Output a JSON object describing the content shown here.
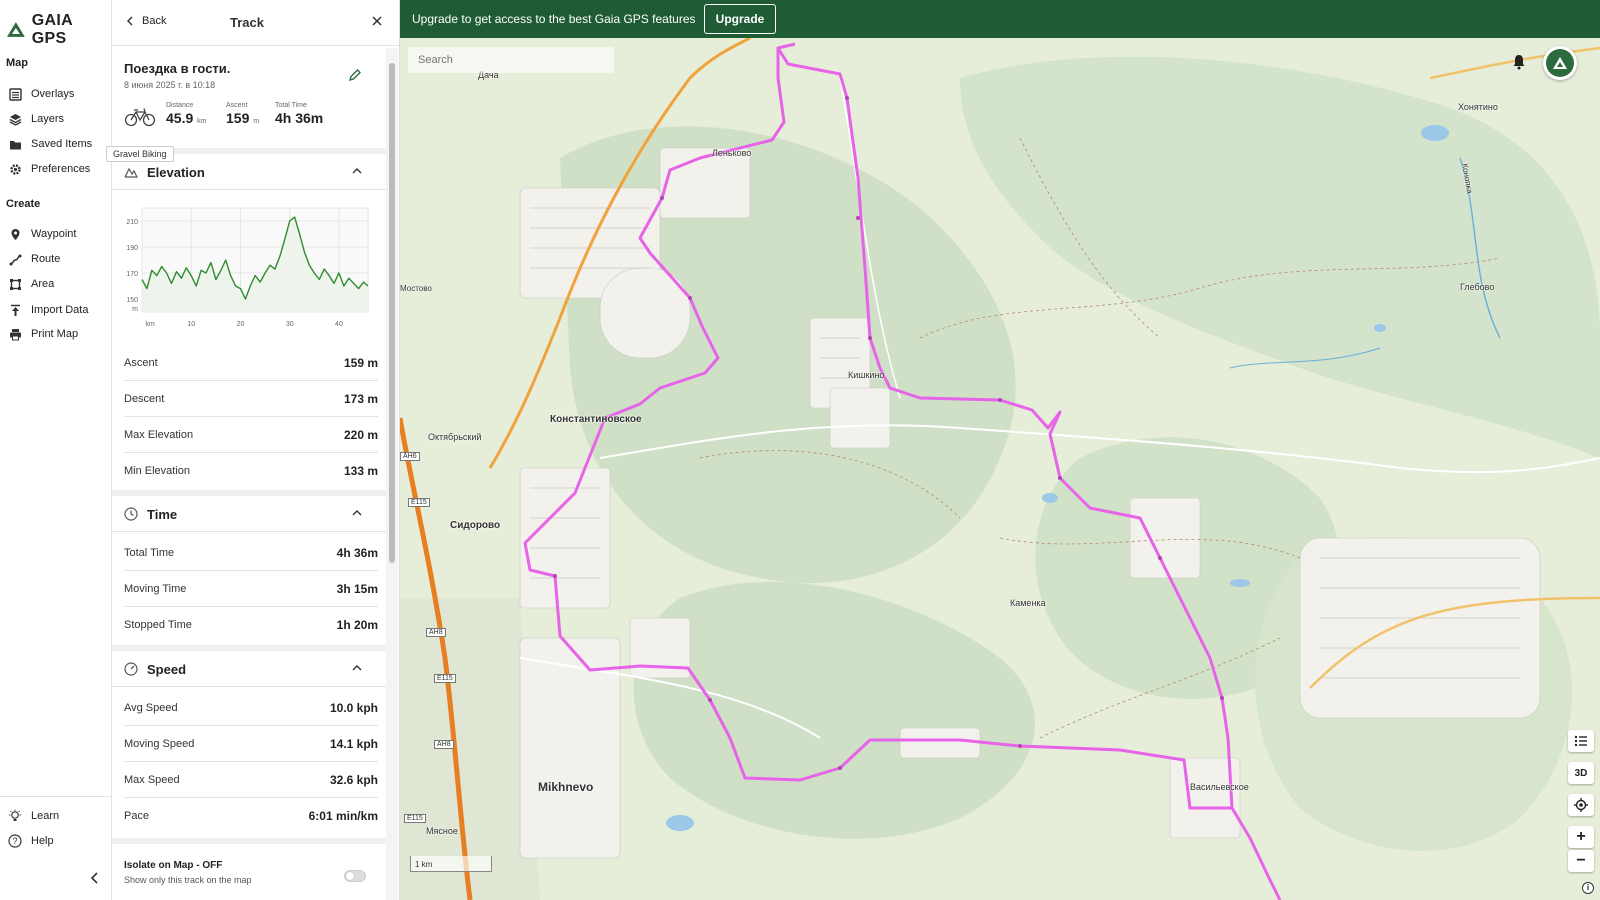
{
  "brand": {
    "name": "GAIA GPS"
  },
  "nav": {
    "map_heading": "Map",
    "map_items": [
      {
        "label": "Overlays",
        "icon": "overlays-icon"
      },
      {
        "label": "Layers",
        "icon": "layers-icon"
      },
      {
        "label": "Saved Items",
        "icon": "folder-icon"
      },
      {
        "label": "Preferences",
        "icon": "gear-icon"
      }
    ],
    "create_heading": "Create",
    "create_items": [
      {
        "label": "Waypoint",
        "icon": "pin-icon"
      },
      {
        "label": "Route",
        "icon": "route-icon"
      },
      {
        "label": "Area",
        "icon": "area-icon"
      },
      {
        "label": "Import Data",
        "icon": "upload-icon"
      },
      {
        "label": "Print Map",
        "icon": "printer-icon"
      }
    ],
    "bottom_items": [
      {
        "label": "Learn",
        "icon": "lightbulb-icon"
      },
      {
        "label": "Help",
        "icon": "help-icon"
      }
    ],
    "tooltip": "Gravel Biking"
  },
  "panel": {
    "back_label": "Back",
    "title": "Track",
    "track_name": "Поездка в гости.",
    "track_date": "8 июня 2025 г. в 10:18",
    "stats": {
      "distance_label": "Distance",
      "distance_value": "45.9",
      "distance_unit": "km",
      "ascent_label": "Ascent",
      "ascent_value": "159",
      "ascent_unit": "m",
      "time_label": "Total Time",
      "time_value": "4h 36m"
    },
    "elevation": {
      "title": "Elevation",
      "rows": [
        {
          "label": "Ascent",
          "value": "159 m"
        },
        {
          "label": "Descent",
          "value": "173 m"
        },
        {
          "label": "Max Elevation",
          "value": "220 m"
        },
        {
          "label": "Min Elevation",
          "value": "133 m"
        }
      ]
    },
    "time": {
      "title": "Time",
      "rows": [
        {
          "label": "Total Time",
          "value": "4h 36m"
        },
        {
          "label": "Moving Time",
          "value": "3h 15m"
        },
        {
          "label": "Stopped Time",
          "value": "1h 20m"
        }
      ]
    },
    "speed": {
      "title": "Speed",
      "rows": [
        {
          "label": "Avg Speed",
          "value": "10.0 kph"
        },
        {
          "label": "Moving Speed",
          "value": "14.1 kph"
        },
        {
          "label": "Max Speed",
          "value": "32.6 kph"
        },
        {
          "label": "Pace",
          "value": "6:01 min/km"
        }
      ]
    },
    "isolate": {
      "title": "Isolate on Map - OFF",
      "subtitle": "Show only this track on the map",
      "enabled": false
    }
  },
  "chart_data": {
    "type": "area",
    "xlabel": "km",
    "ylabel": "m",
    "x_ticks": [
      "km",
      "10",
      "20",
      "30",
      "40"
    ],
    "y_ticks": [
      "210",
      "190",
      "170",
      "150",
      "m"
    ],
    "xlim": [
      0,
      45.9
    ],
    "ylim": [
      140,
      220
    ],
    "x": [
      0,
      1,
      2,
      3,
      4,
      5,
      6,
      7,
      8,
      9,
      10,
      11,
      12,
      13,
      14,
      15,
      16,
      17,
      18,
      19,
      20,
      21,
      22,
      23,
      24,
      25,
      26,
      27,
      28,
      29,
      30,
      31,
      32,
      33,
      34,
      35,
      36,
      37,
      38,
      39,
      40,
      41,
      42,
      43,
      44,
      45,
      45.9
    ],
    "y": [
      165,
      158,
      172,
      168,
      175,
      170,
      162,
      171,
      166,
      174,
      168,
      160,
      172,
      170,
      178,
      165,
      172,
      180,
      168,
      160,
      158,
      150,
      160,
      168,
      163,
      170,
      176,
      173,
      183,
      196,
      210,
      213,
      200,
      186,
      176,
      170,
      165,
      173,
      168,
      162,
      170,
      160,
      166,
      162,
      158,
      163,
      160
    ],
    "line_color": "#2e8b2e",
    "fill_color": "#eef3ec",
    "grid": true
  },
  "banner": {
    "text": "Upgrade to get access to the best Gaia GPS features",
    "button": "Upgrade"
  },
  "map": {
    "search_placeholder": "Search",
    "scale_label": "1 km",
    "controls": {
      "list": "list-icon",
      "3d": "3D",
      "zoom_in": "+",
      "zoom_out": "−"
    },
    "labels": [
      "Леньково",
      "Кишкино",
      "Константиновское",
      "Октябрьский",
      "Сидорово",
      "Каменка",
      "Mikhnevo",
      "Васильевское",
      "Хонятино",
      "Глебово",
      "Мясное",
      "Дача",
      "Конопка",
      "Мостово"
    ],
    "road_badges": [
      "AH6",
      "E115",
      "AH8",
      "E115",
      "AH8",
      "E115"
    ],
    "track_color": "#e763e8"
  }
}
